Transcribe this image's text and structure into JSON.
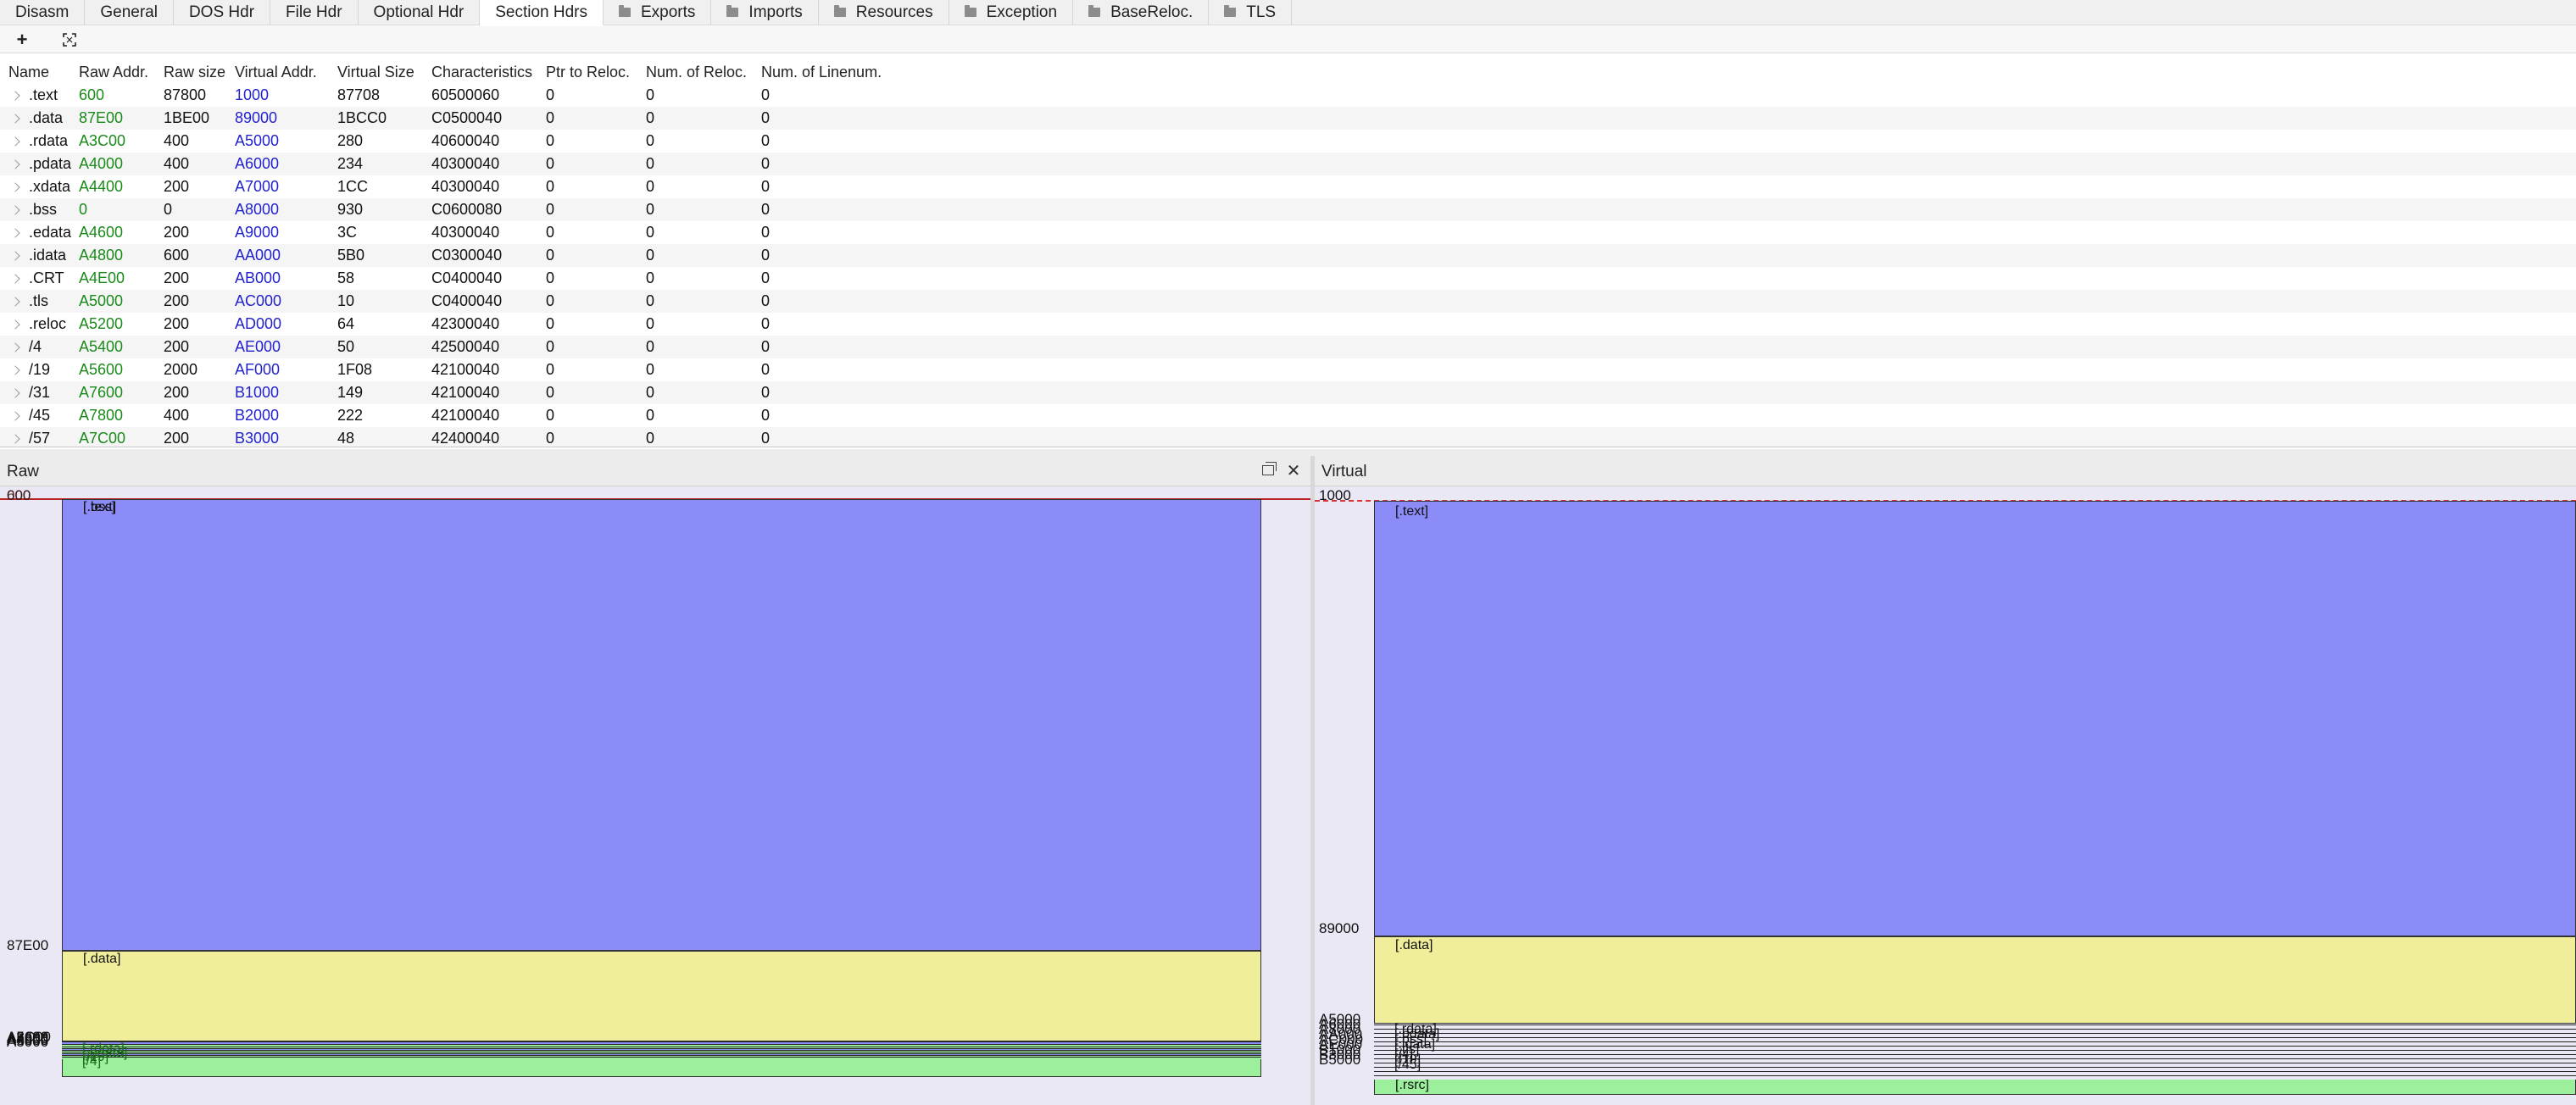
{
  "tabs": [
    {
      "label": "Disasm",
      "icon": "",
      "active": false
    },
    {
      "label": "General",
      "icon": "",
      "active": false
    },
    {
      "label": "DOS Hdr",
      "icon": "",
      "active": false
    },
    {
      "label": "File Hdr",
      "icon": "",
      "active": false
    },
    {
      "label": "Optional Hdr",
      "icon": "",
      "active": false
    },
    {
      "label": "Section Hdrs",
      "icon": "",
      "active": true
    },
    {
      "label": "Exports",
      "icon": "folder-icon",
      "active": false
    },
    {
      "label": "Imports",
      "icon": "folder-icon",
      "active": false
    },
    {
      "label": "Resources",
      "icon": "folder-icon",
      "active": false
    },
    {
      "label": "Exception",
      "icon": "folder-icon",
      "active": false
    },
    {
      "label": "BaseReloc.",
      "icon": "folder-icon",
      "active": false
    },
    {
      "label": "TLS",
      "icon": "folder-icon",
      "active": false
    }
  ],
  "toolbar": {
    "add_label": "+",
    "fit_icon": "fit-view-icon"
  },
  "table": {
    "columns": [
      "Name",
      "Raw Addr.",
      "Raw size",
      "Virtual Addr.",
      "Virtual Size",
      "Characteristics",
      "Ptr to Reloc.",
      "Num. of Reloc.",
      "Num. of Linenum."
    ],
    "rows": [
      [
        ".text",
        "600",
        "87800",
        "1000",
        "87708",
        "60500060",
        "0",
        "0",
        "0"
      ],
      [
        ".data",
        "87E00",
        "1BE00",
        "89000",
        "1BCC0",
        "C0500040",
        "0",
        "0",
        "0"
      ],
      [
        ".rdata",
        "A3C00",
        "400",
        "A5000",
        "280",
        "40600040",
        "0",
        "0",
        "0"
      ],
      [
        ".pdata",
        "A4000",
        "400",
        "A6000",
        "234",
        "40300040",
        "0",
        "0",
        "0"
      ],
      [
        ".xdata",
        "A4400",
        "200",
        "A7000",
        "1CC",
        "40300040",
        "0",
        "0",
        "0"
      ],
      [
        ".bss",
        "0",
        "0",
        "A8000",
        "930",
        "C0600080",
        "0",
        "0",
        "0"
      ],
      [
        ".edata",
        "A4600",
        "200",
        "A9000",
        "3C",
        "40300040",
        "0",
        "0",
        "0"
      ],
      [
        ".idata",
        "A4800",
        "600",
        "AA000",
        "5B0",
        "C0300040",
        "0",
        "0",
        "0"
      ],
      [
        ".CRT",
        "A4E00",
        "200",
        "AB000",
        "58",
        "C0400040",
        "0",
        "0",
        "0"
      ],
      [
        ".tls",
        "A5000",
        "200",
        "AC000",
        "10",
        "C0400040",
        "0",
        "0",
        "0"
      ],
      [
        ".reloc",
        "A5200",
        "200",
        "AD000",
        "64",
        "42300040",
        "0",
        "0",
        "0"
      ],
      [
        "/4",
        "A5400",
        "200",
        "AE000",
        "50",
        "42500040",
        "0",
        "0",
        "0"
      ],
      [
        "/19",
        "A5600",
        "2000",
        "AF000",
        "1F08",
        "42100040",
        "0",
        "0",
        "0"
      ],
      [
        "/31",
        "A7600",
        "200",
        "B1000",
        "149",
        "42100040",
        "0",
        "0",
        "0"
      ],
      [
        "/45",
        "A7800",
        "400",
        "B2000",
        "222",
        "42100040",
        "0",
        "0",
        "0"
      ],
      [
        "/57",
        "A7C00",
        "200",
        "B3000",
        "48",
        "42400040",
        "0",
        "0",
        "0"
      ]
    ]
  },
  "raw_pane": {
    "title": "Raw",
    "restore_icon": "restore-window-icon",
    "close_icon": "close-icon",
    "close_label": "✕",
    "start_addr": "000",
    "start_addr_overlap": "600",
    "text_label": "[.text]",
    "text_label_overlap": "[.bss]",
    "data_addr": "87E00",
    "data_label": "[.data]",
    "cluster_addrs": [
      "A3C00",
      "A4000",
      "A4600",
      "A5000",
      "A5600",
      "A7600",
      "A8000"
    ],
    "cluster_labels": [
      "[.rdata]",
      "[.pdata]",
      "[/19]",
      "[/4]"
    ],
    "text_color": "#8b8cf8",
    "data_color": "#f0ee9a",
    "rsrc_color": "#9cf09c"
  },
  "virtual_pane": {
    "title": "Virtual",
    "start_addr": "1000",
    "text_label": "[.text]",
    "data_addr": "89000",
    "data_label": "[.data]",
    "cluster_addrs": [
      "A5000",
      "A6000",
      "A8000",
      "AA000",
      "AC000",
      "AE000",
      "B1000",
      "B3000",
      "B5000"
    ],
    "cluster_labels": [
      "[.rdata]",
      "[.pdata]",
      "[.bss]",
      "[.idata]",
      "[.tls]",
      "[/4]",
      "[/19]",
      "[/45]"
    ],
    "rsrc_label": "[.rsrc]"
  }
}
